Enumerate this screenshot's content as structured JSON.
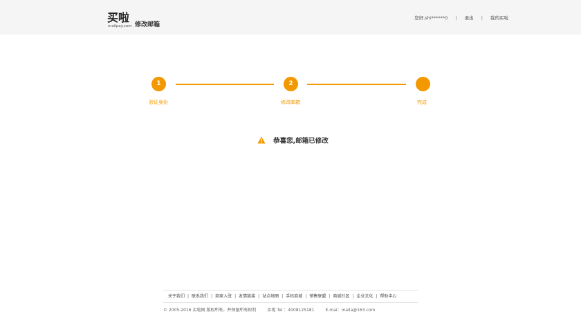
{
  "header": {
    "logo_cn": "买啦",
    "logo_en": "mailpay.com",
    "page_title": "修改邮箱",
    "greeting": "您好,shi******0",
    "logout": "退出",
    "my_account": "我的买啦"
  },
  "steps": [
    {
      "number": "1",
      "label": "验证身份"
    },
    {
      "number": "2",
      "label": "修改邮箱"
    },
    {
      "number": "",
      "label": "完成"
    }
  ],
  "colors": {
    "accent": "#f39800",
    "header_bg": "#f5f5f5"
  },
  "result": {
    "icon": "warning-triangle-icon",
    "message": "恭喜您,邮箱已修改"
  },
  "footer": {
    "links": [
      "关于我们",
      "联系我们",
      "商家入驻",
      "友情链接",
      "站点地图",
      "手机商城",
      "销售联盟",
      "商城社区",
      "企业文化",
      "帮助中心"
    ],
    "copyright": "© 2005-2016 买啦网 版权所有，并保留所有权利",
    "tel": "买啦 Tel ：4008125181",
    "email": "E-mai：maila@163.com"
  }
}
